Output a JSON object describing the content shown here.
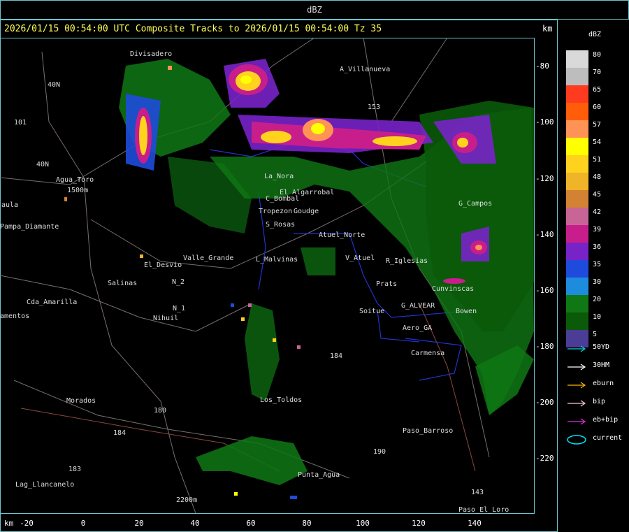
{
  "title_bar": "dBZ",
  "header": {
    "title": "2026/01/15 00:54:00 UTC Composite Tracks to 2026/01/15 00:54:00 Tz 35",
    "unit_right": "km"
  },
  "axes": {
    "y_ticks": [
      "-80",
      "-100",
      "-120",
      "-140",
      "-160",
      "-180",
      "-200",
      "-220"
    ],
    "x_ticks": [
      "-20",
      "0",
      "20",
      "40",
      "60",
      "80",
      "100",
      "120",
      "140"
    ],
    "unit_left": "km"
  },
  "legend": {
    "unit": "dBZ",
    "entries": [
      {
        "label": "80",
        "color": "#d9d9d9"
      },
      {
        "label": "70",
        "color": "#bdbdbd"
      },
      {
        "label": "65",
        "color": "#ff3b1f"
      },
      {
        "label": "60",
        "color": "#ff5d0a"
      },
      {
        "label": "57",
        "color": "#ff9255"
      },
      {
        "label": "54",
        "color": "#ffff00"
      },
      {
        "label": "51",
        "color": "#ffd21e"
      },
      {
        "label": "48",
        "color": "#f0b428"
      },
      {
        "label": "45",
        "color": "#d28232"
      },
      {
        "label": "42",
        "color": "#c86496"
      },
      {
        "label": "39",
        "color": "#c81e8c"
      },
      {
        "label": "36",
        "color": "#7823c8"
      },
      {
        "label": "35",
        "color": "#1e4bdc"
      },
      {
        "label": "30",
        "color": "#1e8cdc"
      },
      {
        "label": "20",
        "color": "#0f7814"
      },
      {
        "label": "10",
        "color": "#0a5a0a"
      },
      {
        "label": "5",
        "color": "#4b3c96"
      }
    ],
    "tracks": [
      {
        "label": "50YD",
        "color": "#00d8e0"
      },
      {
        "label": "30HM",
        "color": "#ffffff"
      },
      {
        "label": "eburn",
        "color": "#ffb400"
      },
      {
        "label": "bip",
        "color": "#ffc8dc"
      },
      {
        "label": "eb+bip",
        "color": "#e030e0"
      },
      {
        "label": "current",
        "color": "#00e0ff"
      }
    ]
  },
  "places": [
    {
      "name": "Divisadero"
    },
    {
      "name": "A_Villanueva"
    },
    {
      "name": "40N"
    },
    {
      "name": "101"
    },
    {
      "name": "Agua_Toro"
    },
    {
      "name": "1500m"
    },
    {
      "name": "Pampa_Diamante"
    },
    {
      "name": "aula"
    },
    {
      "name": "40N"
    },
    {
      "name": "La_Nora"
    },
    {
      "name": "C_Bombal"
    },
    {
      "name": "Tropezon"
    },
    {
      "name": "Goudge"
    },
    {
      "name": "S_Rosas"
    },
    {
      "name": "El_Algarrobal"
    },
    {
      "name": "Atuel_Norte"
    },
    {
      "name": "El_Desvio"
    },
    {
      "name": "Valle_Grande"
    },
    {
      "name": "L_Malvinas"
    },
    {
      "name": "Salinas"
    },
    {
      "name": "V_Atuel"
    },
    {
      "name": "R_Iglesias"
    },
    {
      "name": "Prats"
    },
    {
      "name": "G_ALVEAR"
    },
    {
      "name": "Soitue"
    },
    {
      "name": "Aero_GA"
    },
    {
      "name": "Carmensa"
    },
    {
      "name": "Cda_Amarilla"
    },
    {
      "name": "amentos"
    },
    {
      "name": "N_1"
    },
    {
      "name": "Nihuil"
    },
    {
      "name": "N_2"
    },
    {
      "name": "Morados"
    },
    {
      "name": "Los_Toldos"
    },
    {
      "name": "Paso_Barroso"
    },
    {
      "name": "Punta_Agua"
    },
    {
      "name": "Lag_Llancanelo"
    },
    {
      "name": "2200m"
    },
    {
      "name": "Paso_El_Loro"
    },
    {
      "name": "G_Campos"
    },
    {
      "name": "Bowen"
    },
    {
      "name": "Cunvinscas"
    },
    {
      "name": "153"
    },
    {
      "name": "184"
    },
    {
      "name": "180"
    },
    {
      "name": "184"
    },
    {
      "name": "183"
    },
    {
      "name": "143"
    },
    {
      "name": "190"
    }
  ]
}
